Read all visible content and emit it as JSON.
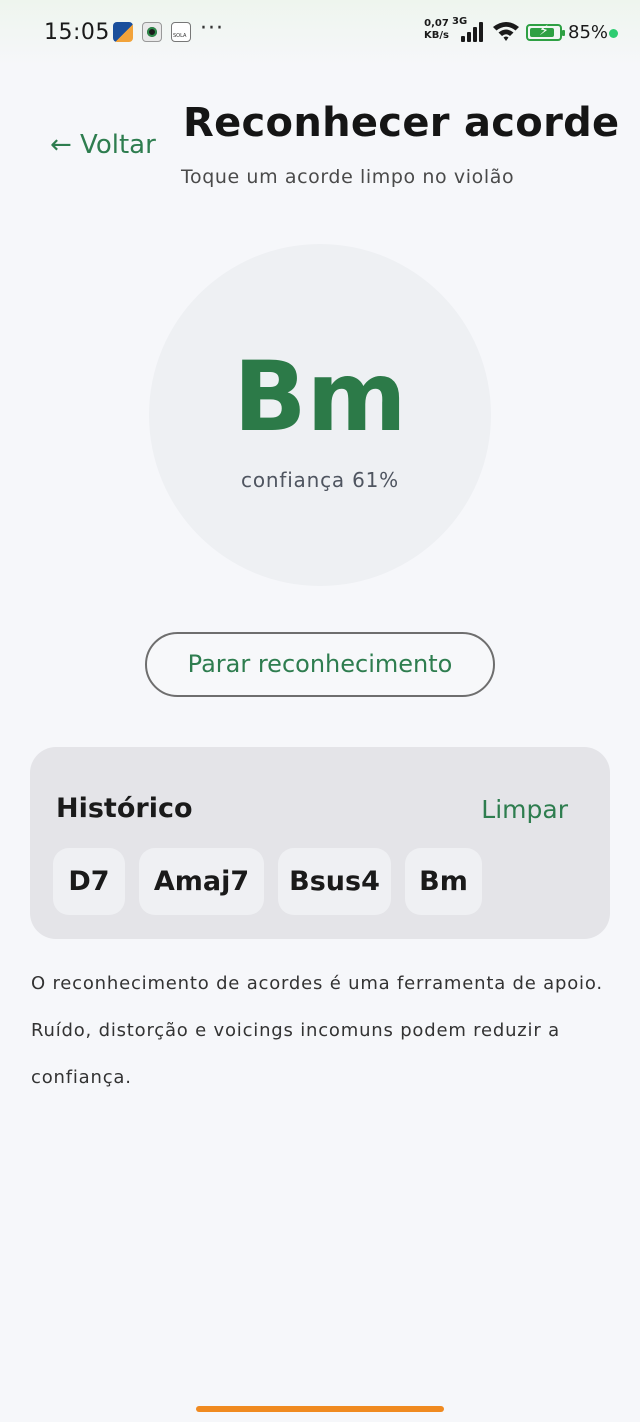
{
  "status_bar": {
    "time": "15:05",
    "more": "···",
    "net_speed": "0,07",
    "net_unit": "KB/s",
    "network_type": "3G",
    "battery_percent": "85%",
    "battery_level": 0.85,
    "colors": {
      "battery": "#2ea043",
      "dot": "#2ecc71"
    }
  },
  "header": {
    "back_label": "← Voltar",
    "title": "Reconhecer acorde",
    "subtitle": "Toque um acorde limpo no violão"
  },
  "recognition": {
    "chord": "Bm",
    "confidence_text": "confiança 61%",
    "confidence": 0.61
  },
  "stop_button_label": "Parar reconhecimento",
  "history": {
    "title": "Histórico",
    "clear_label": "Limpar",
    "chords": [
      "D7",
      "Amaj7",
      "Bsus4",
      "Bm"
    ]
  },
  "note": "O reconhecimento de acordes é uma ferramenta de apoio. Ruído, distorção e voicings incomuns podem reduzir a confiança.",
  "colors": {
    "accent": "#2e7d4f",
    "home_indicator": "#f08a20"
  }
}
